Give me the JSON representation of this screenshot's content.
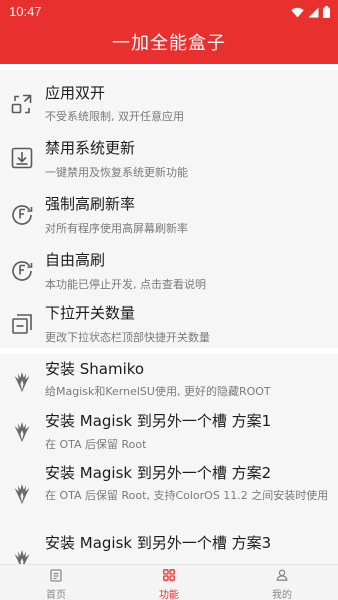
{
  "status_bar": {
    "time": "10:47"
  },
  "app_bar": {
    "title": "一加全能盒子"
  },
  "section1": {
    "items": [
      {
        "title": "应用双开",
        "subtitle": "不受系统限制, 双开任意应用",
        "icon": "dual-app-icon"
      },
      {
        "title": "禁用系统更新",
        "subtitle": "一键禁用及恢复系统更新功能",
        "icon": "download-box-icon"
      },
      {
        "title": "强制高刷新率",
        "subtitle": "对所有程序使用高屏幕刷新率",
        "icon": "refresh-rate-icon"
      },
      {
        "title": "自由高刷",
        "subtitle": "本功能已停止开发, 点击查看说明",
        "icon": "refresh-rate-icon"
      },
      {
        "title": "下拉开关数量",
        "subtitle": "更改下拉状态栏顶部快捷开关数量",
        "icon": "quick-tiles-icon"
      }
    ]
  },
  "section2": {
    "items": [
      {
        "title": "安装 Shamiko",
        "subtitle": "给Magisk和KernelSU使用, 更好的隐藏ROOT",
        "icon": "magisk-icon"
      },
      {
        "title": "安装 Magisk 到另外一个槽 方案1",
        "subtitle": "在 OTA 后保留 Root",
        "icon": "magisk-icon"
      },
      {
        "title": "安装 Magisk 到另外一个槽 方案2",
        "subtitle": "在 OTA 后保留 Root, 支持ColorOS 11.2 之间安装时使用",
        "icon": "magisk-icon"
      },
      {
        "title": "安装 Magisk 到另外一个槽 方案3",
        "subtitle": "",
        "icon": "magisk-icon"
      }
    ]
  },
  "bottom_nav": {
    "items": [
      {
        "label": "首页",
        "icon": "home-doc-icon",
        "active": false
      },
      {
        "label": "功能",
        "icon": "grid-icon",
        "active": true
      },
      {
        "label": "我的",
        "icon": "person-icon",
        "active": false
      }
    ]
  },
  "colors": {
    "accent": "#e8302f",
    "card_bg": "#f6f6f6",
    "subtitle": "#7a7a7a"
  }
}
